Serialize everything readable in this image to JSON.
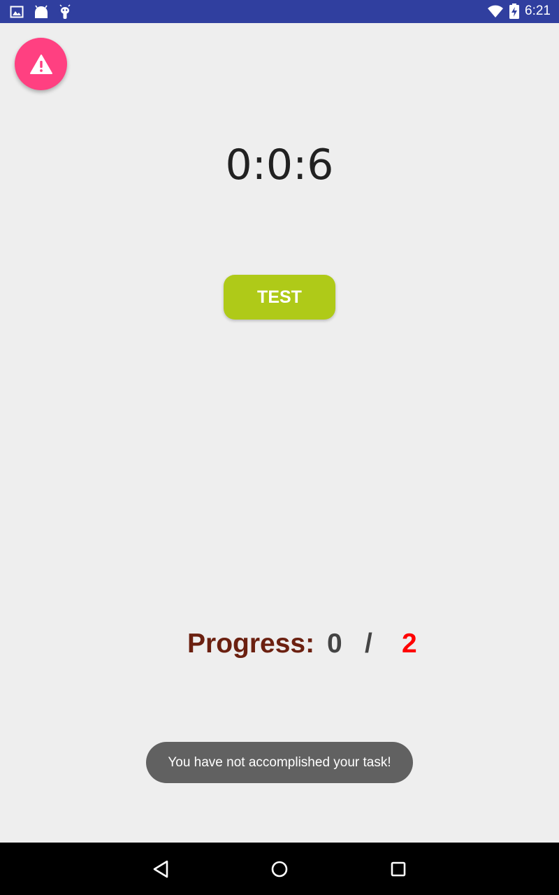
{
  "status_bar": {
    "time": "6:21",
    "icons": [
      "image-icon",
      "android-icon",
      "debug-bug-icon",
      "wifi-icon",
      "battery-charging-icon"
    ]
  },
  "fab": {
    "icon": "warning-icon",
    "color": "#ff4081"
  },
  "timer": {
    "value": "0:0:6"
  },
  "test_button": {
    "label": "TEST",
    "color": "#afca18"
  },
  "progress": {
    "label": "Progress:",
    "current": "0",
    "separator": "/",
    "total": "2",
    "label_color": "#6b2010",
    "total_color": "#ff0000"
  },
  "toast": {
    "message": "You have not accomplished your task!"
  },
  "nav_bar": {
    "buttons": [
      "back-icon",
      "home-icon",
      "recents-icon"
    ]
  },
  "colors": {
    "status_bar": "#303f9f",
    "background": "#eeeeee",
    "nav_bar": "#000000"
  }
}
